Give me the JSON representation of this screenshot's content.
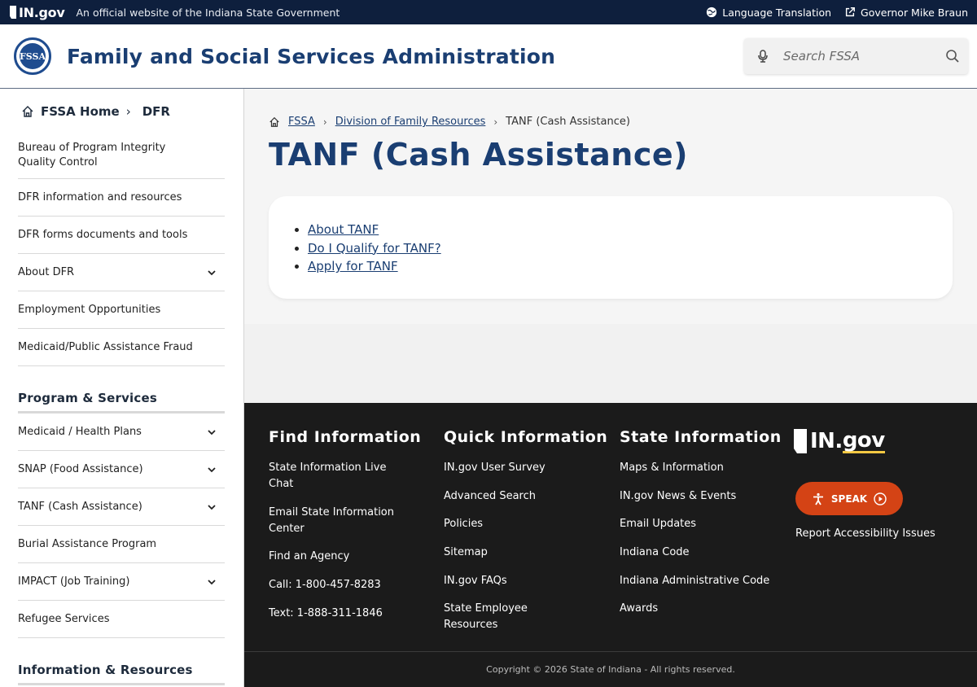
{
  "topbar": {
    "logo_text": "IN.gov",
    "official_text": "An official website of the Indiana State Government",
    "language_label": "Language Translation",
    "governor_label": "Governor Mike Braun"
  },
  "header": {
    "seal_text": "FSSA",
    "title": "Family and Social Services Administration",
    "search_placeholder": "Search FSSA"
  },
  "sidebar": {
    "crumb_home": "FSSA Home",
    "crumb_current": "DFR",
    "items": [
      {
        "label": "Bureau of Program Integrity Quality Control",
        "expandable": false
      },
      {
        "label": "DFR information and resources",
        "expandable": false
      },
      {
        "label": "DFR forms documents and tools",
        "expandable": false
      },
      {
        "label": "About DFR",
        "expandable": true
      },
      {
        "label": "Employment Opportunities",
        "expandable": false
      },
      {
        "label": "Medicaid/Public Assistance Fraud",
        "expandable": false
      }
    ],
    "section_programs": "Program & Services",
    "program_items": [
      {
        "label": "Medicaid / Health Plans",
        "expandable": true
      },
      {
        "label": "SNAP (Food Assistance)",
        "expandable": true
      },
      {
        "label": "TANF (Cash Assistance)",
        "expandable": true
      },
      {
        "label": "Burial Assistance Program",
        "expandable": false
      },
      {
        "label": "IMPACT (Job Training)",
        "expandable": true
      },
      {
        "label": "Refugee Services",
        "expandable": false
      }
    ],
    "section_info": "Information & Resources"
  },
  "main": {
    "breadcrumb": [
      "FSSA",
      "Division of Family Resources",
      "TANF (Cash Assistance)"
    ],
    "title": "TANF (Cash Assistance)",
    "links": [
      "About TANF",
      "Do I Qualify for TANF?",
      "Apply for TANF"
    ]
  },
  "footer": {
    "find_title": "Find Information",
    "find_links": [
      "State Information Live Chat",
      "Email State Information Center",
      "Find an Agency",
      "Call: 1-800-457-8283",
      "Text: 1-888-311-1846"
    ],
    "quick_title": "Quick Information",
    "quick_links": [
      "IN.gov User Survey",
      "Advanced Search",
      "Policies",
      "Sitemap",
      "IN.gov FAQs",
      "State Employee Resources"
    ],
    "state_title": "State Information",
    "state_links": [
      "Maps & Information",
      "IN.gov News & Events",
      "Email Updates",
      "Indiana Code",
      "Indiana Administrative Code",
      "Awards"
    ],
    "logo_in": "IN.",
    "logo_gov": "gov",
    "speak_label": "SPEAK",
    "report_label": "Report Accessibility Issues",
    "copyright": "Copyright © 2026 State of Indiana - All rights reserved."
  },
  "colors": {
    "topbar_bg": "#0e1f3d",
    "brand_blue": "#1a3e72",
    "footer_bg": "#1b1b1b",
    "speak_orange": "#d44315",
    "gov_underline": "#f3c843"
  }
}
